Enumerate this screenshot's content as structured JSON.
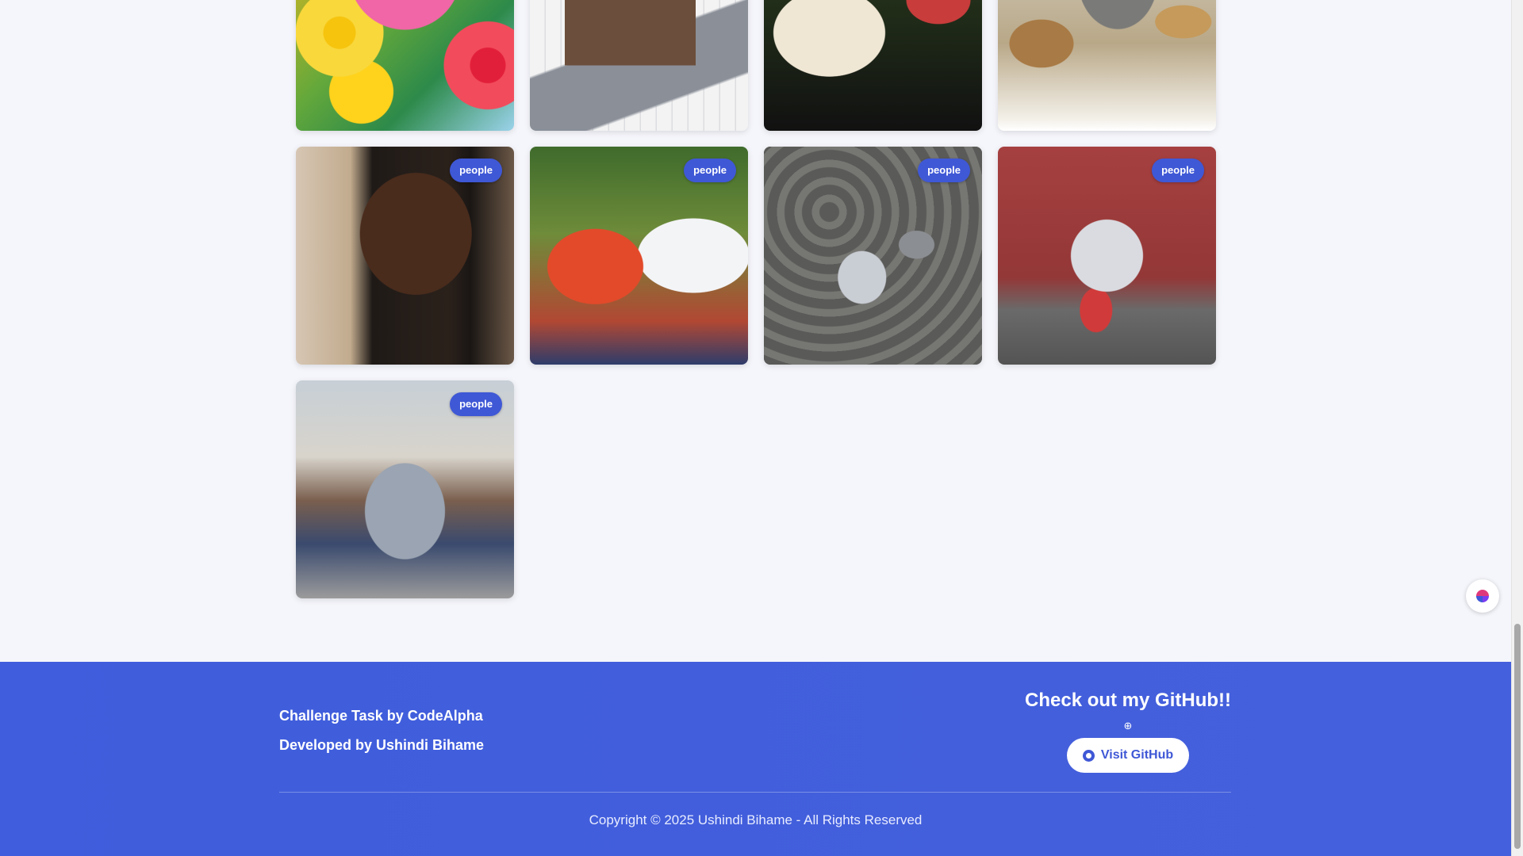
{
  "gallery": {
    "rows": [
      [
        {
          "photo": "flowers",
          "tag": ""
        },
        {
          "photo": "house-model",
          "tag": ""
        },
        {
          "photo": "couple-outdoors",
          "tag": ""
        },
        {
          "photo": "wild-animals",
          "tag": ""
        }
      ],
      [
        {
          "photo": "woman-braids",
          "tag": "people"
        },
        {
          "photo": "couple-flowers",
          "tag": "people"
        },
        {
          "photo": "boy-stone-wall",
          "tag": "people"
        },
        {
          "photo": "boy-red-door",
          "tag": "people"
        }
      ],
      [
        {
          "photo": "man-workout",
          "tag": "people"
        }
      ]
    ]
  },
  "footer": {
    "challenge": "Challenge Task by CodeAlpha",
    "developer": "Developed by Ushindi Bihame",
    "github_heading": "Check out my GitHub!!",
    "github_icon": "pin-icon",
    "github_button": "Visit GitHub",
    "copyright": "Copyright © 2025 Ushindi Bihame - All Rights Reserved"
  },
  "colors": {
    "accent": "#3f58d6",
    "footer_bg": "#4560dc",
    "page_bg": "#f5f6fb"
  }
}
